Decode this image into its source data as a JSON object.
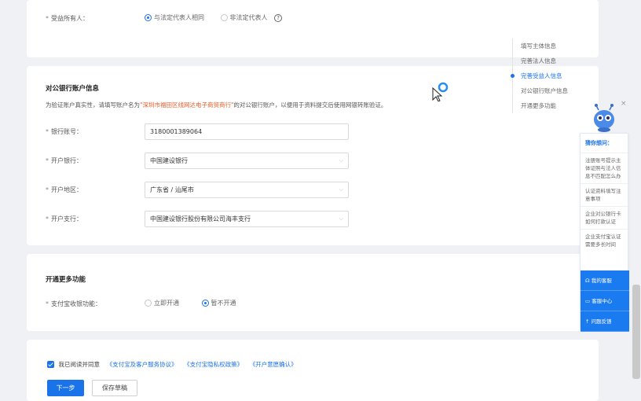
{
  "beneficiary": {
    "label": "受益所有人：",
    "options": [
      "与法定代表人相同",
      "非法定代表人"
    ],
    "selected": 0,
    "help_icon": "question-circle-icon"
  },
  "bank_section": {
    "title": "对公银行账户信息",
    "tip_prefix": "为验证账户真实性，请填写账户名为",
    "tip_highlight": "\"深圳市福田区线网达电子商贸商行\"",
    "tip_suffix": "的对公银行账户，以便用于资料提交后使用网银转账验证。",
    "fields": [
      {
        "label": "银行账号：",
        "value": "3180001389064",
        "dropdown": false
      },
      {
        "label": "开户银行：",
        "value": "中国建设银行",
        "dropdown": true
      },
      {
        "label": "开户地区：",
        "value": "广东省 / 汕尾市",
        "dropdown": true
      },
      {
        "label": "开户支行：",
        "value": "中国建设银行股份有限公司海丰支行",
        "dropdown": true
      }
    ]
  },
  "more_section": {
    "title": "开通更多功能",
    "label": "支付宝收银功能：",
    "options": [
      "立即开通",
      "暂不开通"
    ],
    "selected": 1
  },
  "agreement": {
    "prefix": "我已阅读并同意",
    "links": [
      "《支付宝及客户服务协议》",
      "《支付宝隐私权政策》",
      "《开户意愿确认》"
    ]
  },
  "buttons": {
    "next": "下一步",
    "save": "保存草稿"
  },
  "anchor_nav": {
    "items": [
      "填写主体信息",
      "完善法人信息",
      "完善受益人信息",
      "对公银行账户信息",
      "开通更多功能"
    ],
    "active": 2
  },
  "help_panel": {
    "title": "猜你想问：",
    "questions": [
      "注册账号提示主体证照与法人信息不匹配怎么办",
      "认证资料填写注意事项",
      "企业对公银行卡如何打款认证",
      "企业支付宝认证需要多长时间"
    ],
    "actions": [
      "我的客服",
      "客服中心",
      "问题反馈"
    ],
    "close_icon": "close-icon"
  },
  "colors": {
    "accent": "#1a73e8",
    "highlight": "#e65c2a"
  }
}
